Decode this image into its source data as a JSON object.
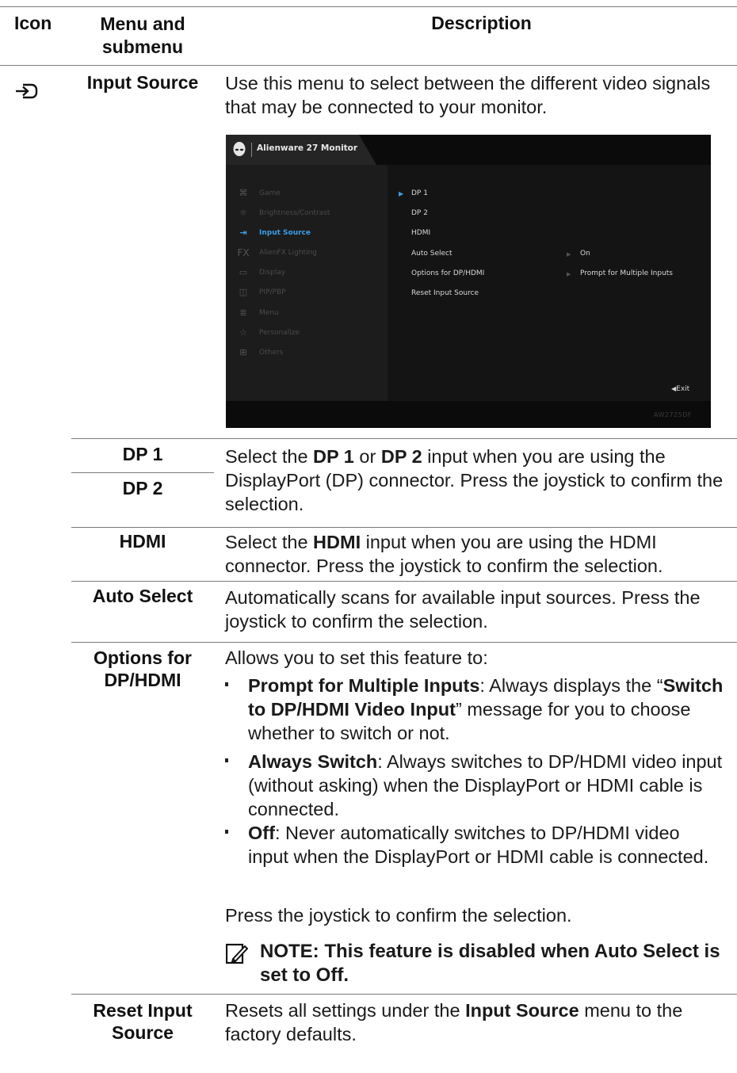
{
  "header": {
    "icon": "Icon",
    "menu": "Menu and submenu",
    "description": "Description"
  },
  "input_source": {
    "menu_label": "Input Source",
    "icon": "input-source-icon",
    "description": "Use this menu to select between the different video signals that may be connected to your monitor."
  },
  "osd": {
    "title": "Alienware 27 Monitor",
    "menu": [
      {
        "label": "Game",
        "icon": "gamepad-icon"
      },
      {
        "label": "Brightness/Contrast",
        "icon": "brightness-icon"
      },
      {
        "label": "Input Source",
        "icon": "input-source-icon"
      },
      {
        "label": "AlienFX Lighting",
        "icon": "fx-icon"
      },
      {
        "label": "Display",
        "icon": "display-icon"
      },
      {
        "label": "PIP/PBP",
        "icon": "pip-icon"
      },
      {
        "label": "Menu",
        "icon": "menu-icon"
      },
      {
        "label": "Personalize",
        "icon": "star-icon"
      },
      {
        "label": "Others",
        "icon": "others-icon"
      }
    ],
    "options": [
      "DP 1",
      "DP 2",
      "HDMI",
      "Auto Select",
      "Options for DP/HDMI",
      "Reset Input Source"
    ],
    "auto_select_value": "On",
    "options_value": "Prompt for Multiple Inputs",
    "exit": "Exit",
    "model": "AW2725DF",
    "accent": "#3a9ee8"
  },
  "rows": {
    "dp1": "DP 1",
    "dp2": "DP 2",
    "dp": {
      "p1": "Select the ",
      "b1": "DP 1",
      "p2": " or ",
      "b2": "DP 2",
      "p3": " input when you are using the DisplayPort (DP) connector. Press the joystick to confirm the selection."
    },
    "hdmi": {
      "label": "HDMI",
      "p1": "Select the ",
      "b1": "HDMI",
      "p2": " input when you are using the HDMI connector. Press the joystick to confirm the selection."
    },
    "auto_select": {
      "label": "Auto Select",
      "text": "Automatically scans for available input sources. Press the joystick to confirm the selection."
    },
    "options": {
      "label": "Options for DP/HDMI",
      "intro": "Allows you to set this feature to:",
      "b1_bold": "Prompt for Multiple Inputs",
      "b1_p1": ": Always displays the “",
      "b1_bold2": "Switch to DP/HDMI Video Input",
      "b1_p2": "” message for you to choose whether to switch or not.",
      "b2_bold": "Always Switch",
      "b2_text": ": Always switches to DP/HDMI video input (without asking) when the DisplayPort or HDMI cable is connected.",
      "b3_bold": "Off",
      "b3_text": ": Never automatically switches to DP/HDMI video input when the DisplayPort or HDMI cable is connected.",
      "confirm": "Press the joystick to confirm the selection.",
      "note": "NOTE: This feature is disabled when Auto Select is set to Off.",
      "note_icon": "note-pencil-icon"
    },
    "reset": {
      "label": "Reset Input Source",
      "p1": "Resets all settings under the ",
      "b1": "Input Source",
      "p2": " menu to the factory defaults."
    }
  }
}
